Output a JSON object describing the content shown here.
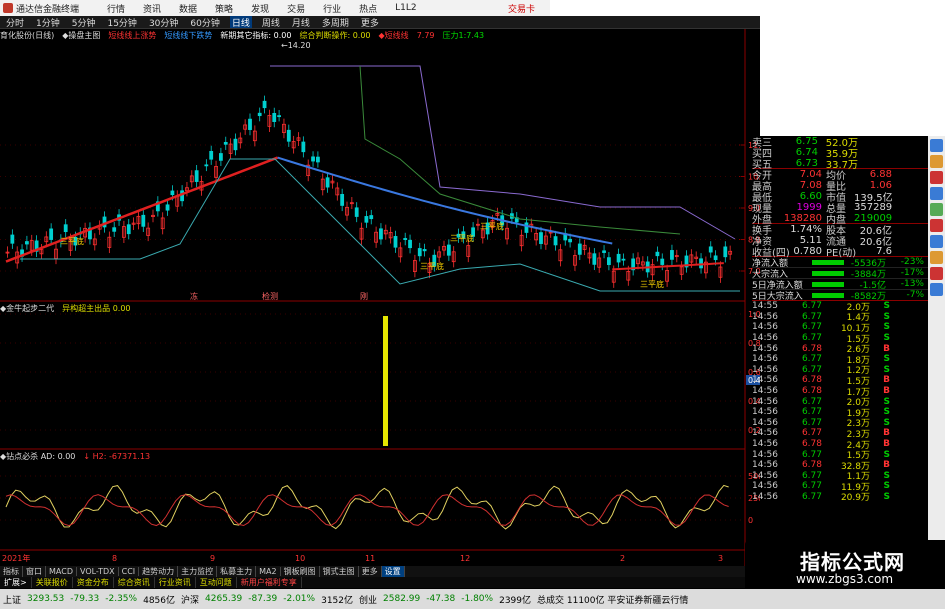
{
  "titlebar": {
    "app_title": "通达信金融终端",
    "menu": [
      "行情",
      "资讯",
      "数据",
      "策略",
      "发现",
      "交易",
      "行业",
      "热点",
      "L1L2"
    ],
    "trade_link": "交易卡"
  },
  "toolbar": {
    "periods": [
      "分时",
      "1分钟",
      "5分钟",
      "15分钟",
      "30分钟",
      "60分钟",
      "日线",
      "周线",
      "月线",
      "多周期",
      "更多"
    ],
    "active_period": "日线"
  },
  "indicator_bars": {
    "main": [
      "育化股份(日线)",
      "◆操盘主图",
      "短线线上涨势",
      "短线线下跌势",
      "新期其它指标: 0.00",
      "综合判断操作: 0.00",
      "◆短线线",
      "7.79",
      "压力1:7.43"
    ],
    "sub1": [
      "◆金牛起步二代",
      "异构超主出品  0.00"
    ],
    "sub2": [
      "◆钻点必杀  AD: 0.00",
      "↓  H2: -67371.13"
    ]
  },
  "chart_labels": {
    "high_marker": "14.20",
    "signals": [
      "三平底",
      "三平底",
      "三平底",
      "三平底",
      "三平底"
    ],
    "bottom_markers": [
      "冻",
      "检测",
      "刚"
    ]
  },
  "axes": {
    "main_ticks": [
      "11.00",
      "10.00",
      "9.00",
      "8.00",
      "7.00"
    ],
    "sub1_ticks": [
      "1.00",
      "0.80",
      "0.60",
      "0.40",
      "0.20"
    ],
    "sub1_marker": "0.46",
    "sub2_ticks": [
      "50000",
      "25000",
      "0"
    ],
    "x_labels": [
      "2021年",
      "8",
      "9",
      "10",
      "11",
      "12",
      "2",
      "3"
    ]
  },
  "quote": {
    "asks": [
      {
        "label": "卖三",
        "price": "6.75",
        "vol": "52.0万"
      },
      {
        "label": "买四",
        "price": "6.74",
        "vol": "35.9万"
      },
      {
        "label": "买五",
        "price": "6.73",
        "vol": "33.7万"
      }
    ],
    "stats": [
      {
        "l1": "今开",
        "v1": "7.04",
        "l2": "均价",
        "v2": "6.88"
      },
      {
        "l1": "最高",
        "v1": "7.08",
        "l2": "量比",
        "v2": "1.06"
      },
      {
        "l1": "最低",
        "v1": "6.60",
        "l2": "市值",
        "v2": "139.5亿"
      },
      {
        "l1": "现量",
        "v1": "1999",
        "l2": "总量",
        "v2": "357289"
      },
      {
        "l1": "外盘",
        "v1": "138280",
        "l2": "内盘",
        "v2": "219009"
      },
      {
        "l1": "换手",
        "v1": "1.74%",
        "l2": "股本",
        "v2": "20.6亿"
      },
      {
        "l1": "净资",
        "v1": "5.11",
        "l2": "流通",
        "v2": "20.6亿"
      },
      {
        "l1": "收益(四)",
        "v1": "0.780",
        "l2": "PE(动)",
        "v2": "7.6"
      }
    ]
  },
  "flows": [
    {
      "label": "净流入额",
      "value": "-5536万",
      "pct": "-23%"
    },
    {
      "label": "大宗流入",
      "value": "-3884万",
      "pct": "-17%"
    },
    {
      "label": "5日净流入额",
      "value": "-1.5亿",
      "pct": "-13%"
    },
    {
      "label": "5日大宗流入",
      "value": "-8582万",
      "pct": "-7%"
    }
  ],
  "ticks": [
    {
      "t": "14:55",
      "p": "6.77",
      "v": "2.0万",
      "bs": "S"
    },
    {
      "t": "14:56",
      "p": "6.77",
      "v": "1.4万",
      "bs": "S"
    },
    {
      "t": "14:56",
      "p": "6.77",
      "v": "10.1万",
      "bs": "S"
    },
    {
      "t": "14:56",
      "p": "6.77",
      "v": "1.5万",
      "bs": "S"
    },
    {
      "t": "14:56",
      "p": "6.78",
      "v": "2.6万",
      "bs": "B"
    },
    {
      "t": "14:56",
      "p": "6.77",
      "v": "1.8万",
      "bs": "S"
    },
    {
      "t": "14:56",
      "p": "6.77",
      "v": "1.2万",
      "bs": "S"
    },
    {
      "t": "14:56",
      "p": "6.78",
      "v": "1.5万",
      "bs": "B"
    },
    {
      "t": "14:56",
      "p": "6.78",
      "v": "1.7万",
      "bs": "B"
    },
    {
      "t": "14:56",
      "p": "6.77",
      "v": "2.0万",
      "bs": "S"
    },
    {
      "t": "14:56",
      "p": "6.77",
      "v": "1.9万",
      "bs": "S"
    },
    {
      "t": "14:56",
      "p": "6.77",
      "v": "2.3万",
      "bs": "S"
    },
    {
      "t": "14:56",
      "p": "6.77",
      "v": "2.3万",
      "bs": "B"
    },
    {
      "t": "14:56",
      "p": "6.78",
      "v": "2.4万",
      "bs": "B"
    },
    {
      "t": "14:56",
      "p": "6.77",
      "v": "1.5万",
      "bs": "S"
    },
    {
      "t": "14:56",
      "p": "6.78",
      "v": "32.8万",
      "bs": "B"
    },
    {
      "t": "14:56",
      "p": "6.77",
      "v": "1.1万",
      "bs": "S"
    },
    {
      "t": "14:56",
      "p": "6.77",
      "v": "11.9万",
      "bs": "S"
    },
    {
      "t": "14:56",
      "p": "6.77",
      "v": "20.9万",
      "bs": "S"
    }
  ],
  "bottom_tabs": [
    "指标",
    "窗口",
    "MACD",
    "VOL-TDX",
    "CCI",
    "趋势动力",
    "主力监控",
    "私募主力",
    "MA2",
    "钢板刷图",
    "钢式主图",
    "更多",
    "设置"
  ],
  "sub_tabs": [
    "扩展>",
    "关联报价",
    "资金分布",
    "综合资讯",
    "行业资讯",
    "互动问题",
    "新用户福利专享"
  ],
  "statusbar": [
    {
      "name": "上证",
      "value": "3293.53",
      "chg": "-79.33",
      "pct": "-2.35%",
      "amt": "4856亿"
    },
    {
      "name": "沪深",
      "value": "4265.39",
      "chg": "-87.39",
      "pct": "-2.01%",
      "amt": "3152亿"
    },
    {
      "name": "创业",
      "value": "2582.99",
      "chg": "-47.38",
      "pct": "-1.80%",
      "amt": "2399亿"
    }
  ],
  "status_extra": "总成交  11100亿 平安证券新疆云行情",
  "watermark": {
    "title": "指标公式网",
    "url": "www.zbgs3.com"
  },
  "colors": {
    "up": "#ff3030",
    "down": "#00d0d0",
    "ma_red": "#e02020",
    "ma_blue": "#3a78e0"
  }
}
